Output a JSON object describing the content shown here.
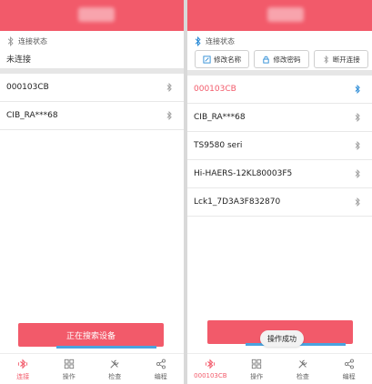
{
  "colors": {
    "accent": "#f25a6a",
    "bluetooth_active": "#2a8bd6",
    "icon_grey": "#9a9a9a"
  },
  "left": {
    "status_label": "连接状态",
    "status_value": "未连接",
    "devices": [
      {
        "name": "000103CB",
        "icon": "bluetooth-icon"
      },
      {
        "name": "CIB_RA***68",
        "icon": "bluetooth-icon"
      }
    ],
    "primary_button": "正在搜索设备",
    "nav": [
      {
        "label": "连接",
        "icon": "bluetooth-connect-icon"
      },
      {
        "label": "操作",
        "icon": "grid-icon"
      },
      {
        "label": "检查",
        "icon": "tools-icon"
      },
      {
        "label": "编程",
        "icon": "share-icon"
      }
    ]
  },
  "right": {
    "status_label": "连接状态",
    "buttons": [
      {
        "label": "修改名称",
        "icon": "edit-icon"
      },
      {
        "label": "修改密码",
        "icon": "lock-icon"
      },
      {
        "label": "断开连接",
        "icon": "bluetooth-icon"
      }
    ],
    "devices": [
      {
        "name": "000103CB",
        "icon": "bluetooth-icon"
      },
      {
        "name": "CIB_RA***68",
        "icon": "bluetooth-icon"
      },
      {
        "name": "TS9580 seri",
        "icon": "bluetooth-icon"
      },
      {
        "name": "Hi-HAERS-12KL80003F5",
        "icon": "bluetooth-icon"
      },
      {
        "name": "Lck1_7D3A3F832870",
        "icon": "bluetooth-icon"
      }
    ],
    "toast": "操作成功",
    "nav": [
      {
        "label": "000103CB",
        "icon": "bluetooth-connect-icon"
      },
      {
        "label": "操作",
        "icon": "grid-icon"
      },
      {
        "label": "检查",
        "icon": "tools-icon"
      },
      {
        "label": "编程",
        "icon": "share-icon"
      }
    ]
  }
}
